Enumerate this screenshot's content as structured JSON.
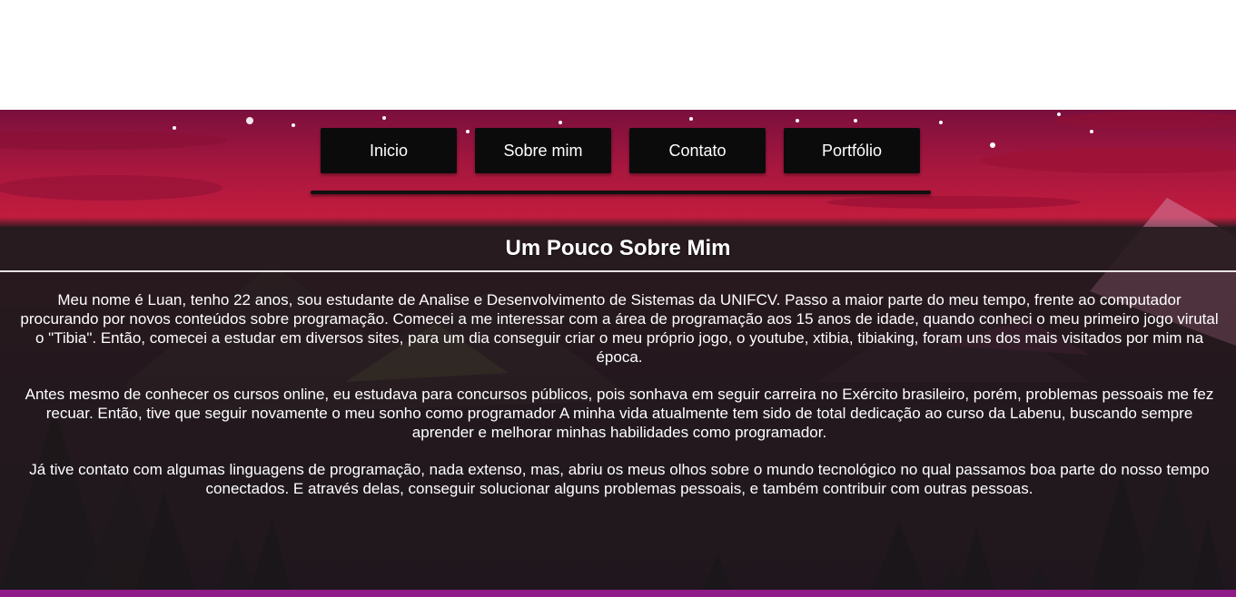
{
  "nav": {
    "items": [
      {
        "label": "Inicio"
      },
      {
        "label": "Sobre mim"
      },
      {
        "label": "Contato"
      },
      {
        "label": "Portfólio"
      }
    ]
  },
  "about": {
    "title": "Um Pouco Sobre Mim",
    "paragraphs": [
      "Meu nome é Luan, tenho 22 anos, sou estudante de Analise e Desenvolvimento de Sistemas da UNIFCV. Passo a maior parte do meu tempo, frente ao computador procurando por novos conteúdos sobre programação. Comecei a me interessar com a área de programação aos 15 anos de idade, quando conheci o meu primeiro jogo virutal o \"Tibia\". Então, comecei a estudar em diversos sites, para um dia conseguir criar o meu próprio jogo, o youtube, xtibia, tibiaking, foram uns dos mais visitados por mim na época.",
      "Antes mesmo de conhecer os cursos online, eu estudava para concursos públicos, pois sonhava em seguir carreira no Exército brasileiro, porém, problemas pessoais me fez recuar. Então, tive que seguir novamente o meu sonho como programador A minha vida atualmente tem sido de total dedicação ao curso da Labenu, buscando sempre aprender e melhorar minhas habilidades como programador.",
      "Já tive contato com algumas linguagens de programação, nada extenso, mas, abriu os meus olhos sobre o mundo tecnológico no qual passamos boa parte do nosso tempo conectados. E através delas, conseguir solucionar alguns problemas pessoais, e também contribuir com outras pessoas."
    ]
  },
  "colors": {
    "sky_top": "#7a0f3d",
    "sky_bottom": "#c21c3d",
    "nav_button_bg": "#0c0b0c",
    "panel_bg": "#2a1a22",
    "bottom_strip": "#8e1b87"
  }
}
